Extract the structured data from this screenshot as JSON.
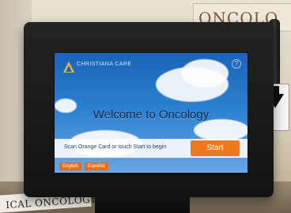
{
  "wall_sign": {
    "text": "ONCOLO"
  },
  "paper_label": {
    "text": "ICAL ONCOLOGY"
  },
  "kiosk": {
    "logo_text": "CHRISTIANA CARE",
    "help_icon": "?",
    "welcome": "Welcome to Oncology",
    "instruction": "Scan Orange Card or touch Start to begin",
    "start_label": "Start",
    "languages": [
      {
        "label": "English"
      },
      {
        "label": "Español"
      }
    ],
    "colors": {
      "accent": "#f07a1b",
      "sky_top": "#1a63b8",
      "sky_bottom": "#6aa7e6"
    }
  },
  "icons": {
    "side_sign_arrow": "down-arrow-icon",
    "kiosk_logo": "triangle-logo-icon"
  }
}
